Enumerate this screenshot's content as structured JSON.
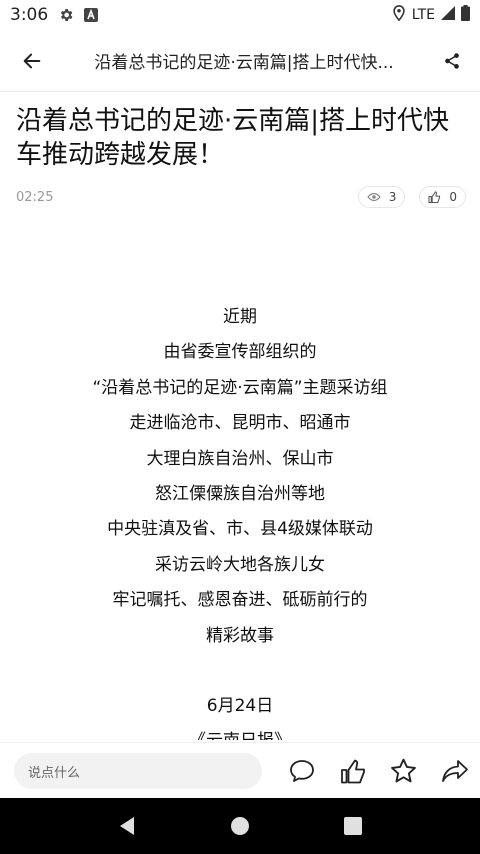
{
  "status_bar": {
    "time": "3:06",
    "network": "LTE"
  },
  "header": {
    "title": "沿着总书记的足迹·云南篇|搭上时代快..."
  },
  "article": {
    "title": "沿着总书记的足迹·云南篇|搭上时代快车推动跨越发展！",
    "time": "02:25",
    "views": "3",
    "likes": "0",
    "body_lines": [
      "近期",
      "由省委宣传部组织的",
      "“沿着总书记的足迹·云南篇”主题采访组",
      "走进临沧市、昆明市、昭通市",
      "大理白族自治州、保山市",
      "怒江傈僳族自治州等地",
      "中央驻滇及省、市、县4级媒体联动",
      "采访云岭大地各族儿女",
      "牢记嘱托、感恩奋进、砥砺前行的",
      "精彩故事",
      "",
      "6月24日",
      "《云南日报》"
    ]
  },
  "comment_bar": {
    "placeholder": "说点什么"
  },
  "colors": {
    "accent": "#222222",
    "navbar": "#000000",
    "input_bg": "#f2f2f2"
  }
}
